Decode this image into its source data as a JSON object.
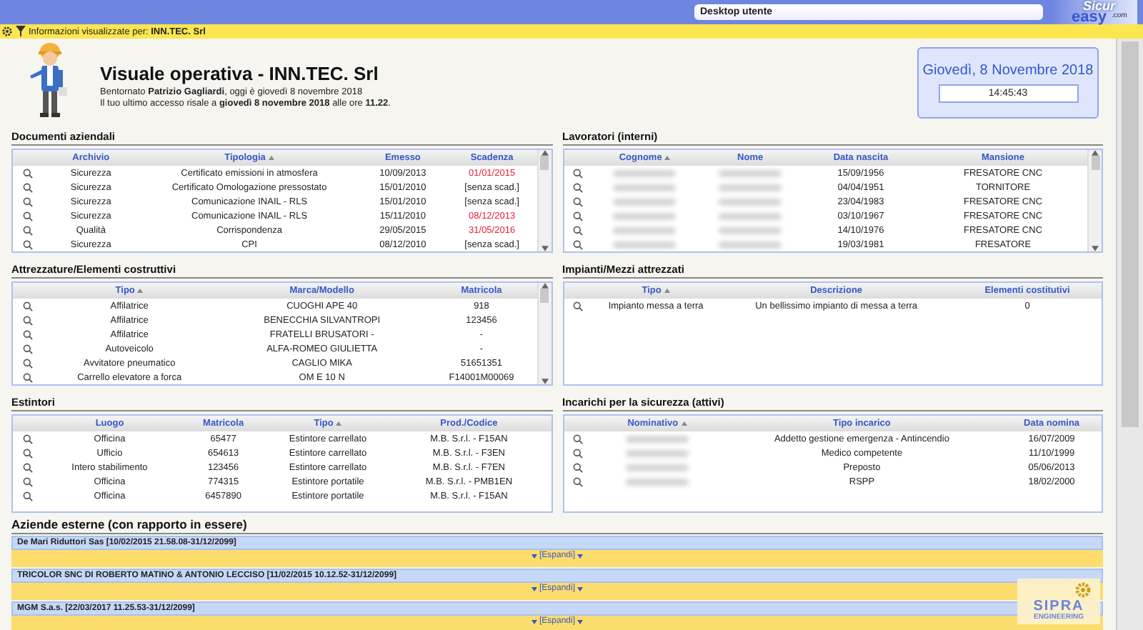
{
  "top_bar": {
    "desktop_select": "Desktop utente",
    "logo": {
      "top": "Sicur",
      "main": "easy",
      "suffix": ".com"
    }
  },
  "info_bar": {
    "text": "Informazioni visualizzate per: **INN.TEC. Srl**"
  },
  "header": {
    "title": "Visuale operativa - INN.TEC. Srl",
    "welcome": "Bentornato **Patrizio Gagliardi**, oggi è giovedì 8 novembre 2018",
    "last_access": "Il tuo ultimo accesso risale a **giovedì 8 novembre 2018** alle ore **11.22**.",
    "date": "Giovedì, 8 Novembre 2018",
    "time": "14:45:43"
  },
  "sections": [
    {
      "title": "Documenti aziendali",
      "scrollbar": true,
      "columns": [
        {
          "label": "Archivio",
          "sorted": false
        },
        {
          "label": "Tipologia",
          "sorted": true
        },
        {
          "label": "Emesso",
          "sorted": false
        },
        {
          "label": "Scadenza",
          "sorted": false
        }
      ],
      "rows": [
        {
          "cells": [
            "Sicurezza",
            "Certificato emissioni in atmosfera",
            "10/09/2013",
            "01/01/2015"
          ],
          "expired": true
        },
        {
          "cells": [
            "Sicurezza",
            "Certificato Omologazione pressostato",
            "15/01/2010",
            "[senza scad.]"
          ],
          "expired": false
        },
        {
          "cells": [
            "Sicurezza",
            "Comunicazione INAIL - RLS",
            "15/01/2010",
            "[senza scad.]"
          ],
          "expired": false
        },
        {
          "cells": [
            "Sicurezza",
            "Comunicazione INAIL - RLS",
            "15/11/2010",
            "08/12/2013"
          ],
          "expired": true
        },
        {
          "cells": [
            "Qualità",
            "Corrispondenza",
            "29/05/2015",
            "31/05/2016"
          ],
          "expired": true
        },
        {
          "cells": [
            "Sicurezza",
            "CPI",
            "08/12/2010",
            "[senza scad.]"
          ],
          "expired": false
        }
      ]
    },
    {
      "title": "Lavoratori (interni)",
      "scrollbar": true,
      "columns": [
        {
          "label": "Cognome",
          "sorted": true
        },
        {
          "label": "Nome",
          "sorted": false
        },
        {
          "label": "Data nascita",
          "sorted": false
        },
        {
          "label": "Mansione",
          "sorted": false
        }
      ],
      "rows": [
        {
          "cells": [
            {
              "kind": "blurred"
            },
            {
              "kind": "blurred"
            },
            "15/09/1956",
            "FRESATORE CNC"
          ],
          "expired": false
        },
        {
          "cells": [
            {
              "kind": "blurred"
            },
            {
              "kind": "blurred"
            },
            "04/04/1951",
            "TORNITORE"
          ],
          "expired": false
        },
        {
          "cells": [
            {
              "kind": "blurred"
            },
            {
              "kind": "blurred"
            },
            "23/04/1983",
            "FRESATORE CNC"
          ],
          "expired": false
        },
        {
          "cells": [
            {
              "kind": "blurred"
            },
            {
              "kind": "blurred"
            },
            "03/10/1967",
            "FRESATORE CNC"
          ],
          "expired": false
        },
        {
          "cells": [
            {
              "kind": "blurred"
            },
            {
              "kind": "blurred"
            },
            "14/10/1976",
            "FRESATORE CNC"
          ],
          "expired": false
        },
        {
          "cells": [
            {
              "kind": "blurred"
            },
            {
              "kind": "blurred"
            },
            "19/03/1981",
            "FRESATORE"
          ],
          "expired": false
        }
      ]
    },
    {
      "title": "Attrezzature/Elementi costruttivi",
      "scrollbar": true,
      "columns": [
        {
          "label": "Tipo",
          "sorted": true
        },
        {
          "label": "Marca/Modello",
          "sorted": false
        },
        {
          "label": "Matricola",
          "sorted": false
        }
      ],
      "rows": [
        {
          "cells": [
            "Affilatrice",
            "CUOGHI APE 40",
            "918"
          ],
          "expired": false
        },
        {
          "cells": [
            "Affilatrice",
            "BENECCHIA SILVANTROPI",
            "123456"
          ],
          "expired": false
        },
        {
          "cells": [
            "Affilatrice",
            "FRATELLI BRUSATORI -",
            "-"
          ],
          "expired": false
        },
        {
          "cells": [
            "Autoveicolo",
            "ALFA-ROMEO GIULIETTA",
            "-"
          ],
          "expired": false
        },
        {
          "cells": [
            "Avvitatore pneumatico",
            "CAGLIO MIKA",
            "51651351"
          ],
          "expired": false
        },
        {
          "cells": [
            "Carrello elevatore a forca",
            "OM E 10 N",
            "F14001M00069"
          ],
          "expired": false
        }
      ]
    },
    {
      "title": "Impianti/Mezzi attrezzati",
      "scrollbar": false,
      "columns": [
        {
          "label": "Tipo",
          "sorted": true
        },
        {
          "label": "Descrizione",
          "sorted": false
        },
        {
          "label": "Elementi costitutivi",
          "sorted": false
        }
      ],
      "rows": [
        {
          "cells": [
            "Impianto messa a terra",
            "Un bellissimo impianto di messa a terra",
            "0"
          ],
          "expired": false
        }
      ]
    },
    {
      "title": "Estintori",
      "scrollbar": false,
      "columns": [
        {
          "label": "Luogo",
          "sorted": false
        },
        {
          "label": "Matricola",
          "sorted": false
        },
        {
          "label": "Tipo",
          "sorted": true
        },
        {
          "label": "Prod./Codice",
          "sorted": false
        }
      ],
      "rows": [
        {
          "cells": [
            "Officina",
            "65477",
            "Estintore carrellato",
            "M.B. S.r.l. - F15AN"
          ],
          "expired": false
        },
        {
          "cells": [
            "Ufficio",
            "654613",
            "Estintore carrellato",
            "M.B. S.r.l. - F3EN"
          ],
          "expired": false
        },
        {
          "cells": [
            "Intero stabilimento",
            "123456",
            "Estintore carrellato",
            "M.B. S.r.l. - F7EN"
          ],
          "expired": false
        },
        {
          "cells": [
            "Officina",
            "774315",
            "Estintore portatile",
            "M.B. S.r.l. - PMB1EN"
          ],
          "expired": false
        },
        {
          "cells": [
            "Officina",
            "6457890",
            "Estintore portatile",
            "M.B. S.r.l. - F15AN"
          ],
          "expired": false
        }
      ]
    },
    {
      "title": "Incarichi per la sicurezza (attivi)",
      "scrollbar": false,
      "columns": [
        {
          "label": "Nominativo",
          "sorted": true
        },
        {
          "label": "Tipo incarico",
          "sorted": false
        },
        {
          "label": "Data nomina",
          "sorted": false
        }
      ],
      "rows": [
        {
          "cells": [
            {
              "kind": "blurred"
            },
            "Addetto gestione emergenza - Antincendio",
            "16/07/2009"
          ],
          "expired": false
        },
        {
          "cells": [
            {
              "kind": "blurred"
            },
            "Medico competente",
            "11/10/1999"
          ],
          "expired": false
        },
        {
          "cells": [
            {
              "kind": "blurred"
            },
            "Preposto",
            "05/06/2013"
          ],
          "expired": false
        },
        {
          "cells": [
            {
              "kind": "blurred"
            },
            "RSPP",
            "18/02/2000"
          ],
          "expired": false
        }
      ]
    }
  ],
  "external_companies": {
    "title": "Aziende esterne (con rapporto in essere)",
    "items": [
      {
        "name": "De Mari Riduttori Sas [10/02/2015 21.58.08-31/12/2099]",
        "expand": "[Espandi]"
      },
      {
        "name": "TRICOLOR SNC DI ROBERTO MATINO & ANTONIO LECCISO [11/02/2015 10.12.52-31/12/2099]",
        "expand": "[Espandi]"
      },
      {
        "name": "MGM S.a.s. [22/03/2017 11.25.53-31/12/2099]",
        "expand": "[Espandi]"
      }
    ]
  },
  "brand_badge": {
    "line1": "SIPRA",
    "line2": "ENGINEERING"
  }
}
